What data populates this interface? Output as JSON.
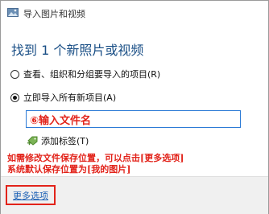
{
  "window": {
    "title": "导入图片和视频"
  },
  "main": {
    "heading": "找到 1 个新照片或视频",
    "option_review": "查看、组织和分组要导入的项目(R)",
    "option_import_all": "立即导入所有新项目(A)",
    "name_input_value": "⑥输入文件名",
    "add_tags_label": "添加标签(T)"
  },
  "annotation": {
    "line1": "如需修改文件保存位置，可以点击[更多选项]",
    "line2": "系统默认保存位置为[我的图片]"
  },
  "footer": {
    "more_options": "更多选项"
  },
  "colors": {
    "accent": "#1a4f86",
    "annotation": "#e2231a",
    "input_border": "#2d7bd6"
  }
}
